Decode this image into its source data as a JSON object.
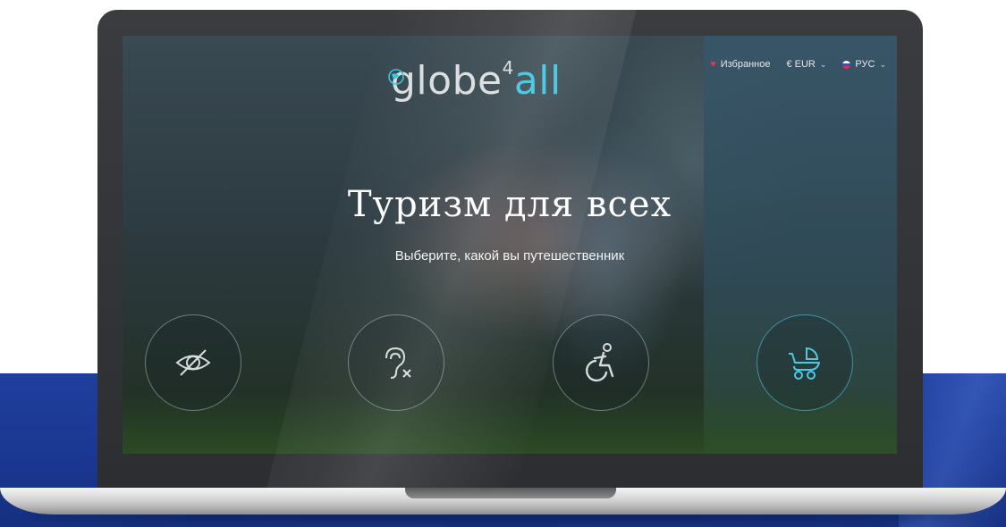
{
  "logo": {
    "text": "globe",
    "superscript": "4",
    "suffix": "all"
  },
  "nav": {
    "favorites": "Избранное",
    "currency": "€ EUR",
    "language": "РУС"
  },
  "hero": {
    "title": "Туризм для всех",
    "subtitle": "Выберите, какой вы путешественник"
  },
  "travellers": [
    {
      "icon": "eye-crossed-icon"
    },
    {
      "icon": "ear-crossed-icon"
    },
    {
      "icon": "wheelchair-icon"
    },
    {
      "icon": "stroller-icon"
    }
  ],
  "colors": {
    "accent": "#38c3e0",
    "heart": "#e23a4a",
    "backdrop_blue": "#1f3f9c"
  }
}
